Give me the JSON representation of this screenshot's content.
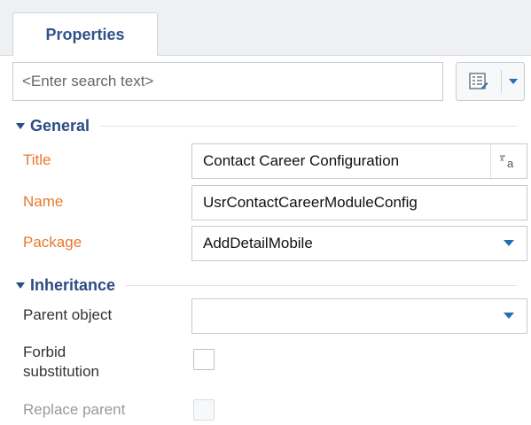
{
  "tabs": {
    "active_label": "Properties"
  },
  "search": {
    "placeholder": "<Enter search text>",
    "value": ""
  },
  "sections": {
    "general": {
      "title": "General",
      "title_label": "Title",
      "title_value": "Contact Career Configuration",
      "localize_icon": "localize-icon",
      "name_label": "Name",
      "name_value": "UsrContactCareerModuleConfig",
      "package_label": "Package",
      "package_value": "AddDetailMobile"
    },
    "inheritance": {
      "title": "Inheritance",
      "parent_label": "Parent object",
      "parent_value": "",
      "forbid_label_line1": "Forbid",
      "forbid_label_line2": "substitution",
      "forbid_checked": false,
      "replace_label": "Replace parent",
      "replace_checked": false,
      "replace_disabled": true
    }
  },
  "colors": {
    "accent": "#2b4c83",
    "required_label": "#e8772e",
    "dropdown_arrow": "#1f6fb5"
  }
}
